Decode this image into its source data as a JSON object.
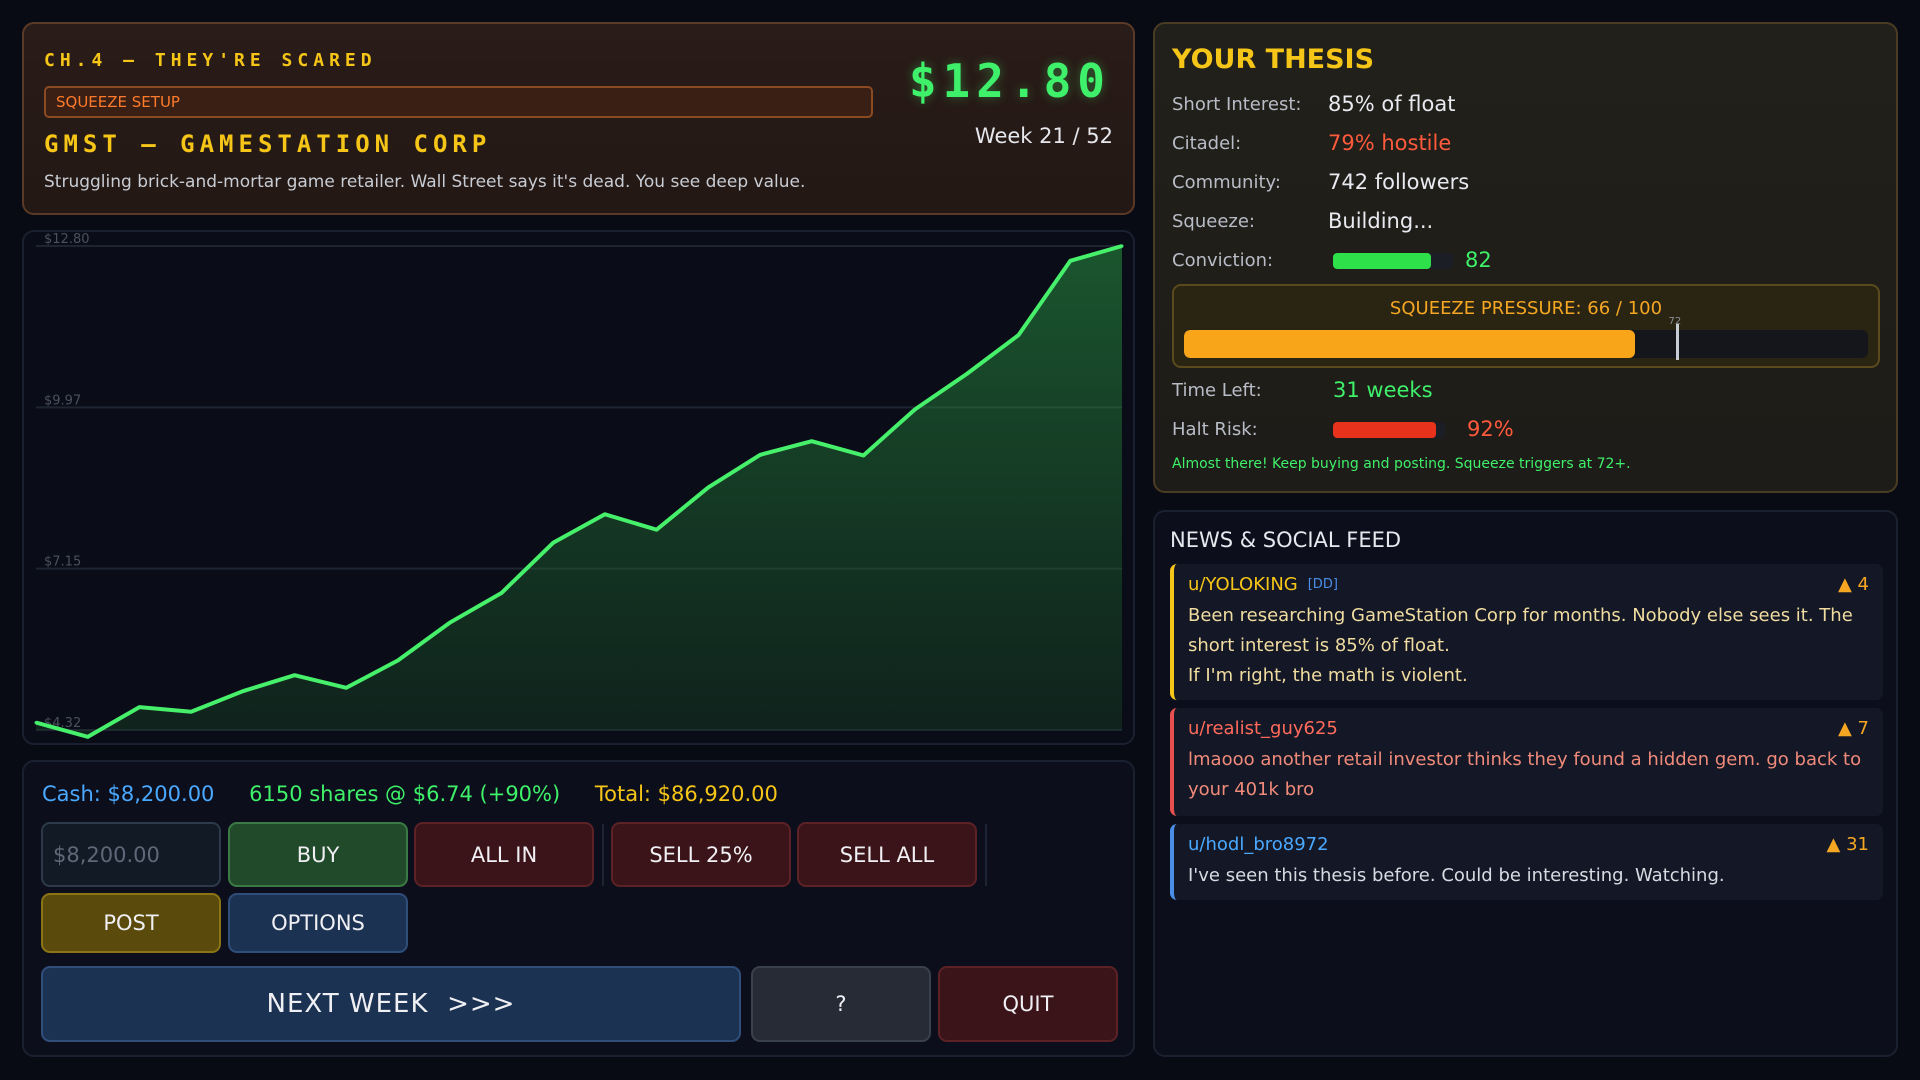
{
  "header": {
    "chapter": "CH.4 — THEY'RE SCARED",
    "tag": "SQUEEZE SETUP",
    "ticker": "GMST — GAMESTATION CORP",
    "description": "Struggling brick-and-mortar game retailer. Wall Street says it's dead. You see deep value.",
    "price": "$12.80",
    "week": "Week 21 / 52"
  },
  "chart_data": {
    "type": "area",
    "title": "",
    "xlabel": "",
    "ylabel": "",
    "ytick_labels": [
      "$12.80",
      "$9.97",
      "$7.15",
      "$4.32"
    ],
    "ylim": [
      4.32,
      12.8
    ],
    "grid": true,
    "x": [
      1,
      2,
      3,
      4,
      5,
      6,
      7,
      8,
      9,
      10,
      11,
      12,
      13,
      14,
      15,
      16,
      17,
      18,
      19,
      20,
      21,
      22
    ],
    "values": [
      4.45,
      4.2,
      4.72,
      4.64,
      5.0,
      5.28,
      5.06,
      5.54,
      6.2,
      6.72,
      7.6,
      8.1,
      7.83,
      8.57,
      9.14,
      9.38,
      9.13,
      9.94,
      10.56,
      11.24,
      12.54,
      12.8
    ],
    "color": "#47f06a"
  },
  "trade": {
    "cash": "Cash: $8,200.00",
    "shares": "6150 shares @ $6.74 (+90%)",
    "total": "Total: $86,920.00",
    "amount_placeholder": "$8,200.00",
    "buy": "BUY",
    "all_in": "ALL IN",
    "sell_25": "SELL 25%",
    "sell_all": "SELL ALL",
    "post": "POST",
    "options": "OPTIONS",
    "next_week": "NEXT WEEK  >>>",
    "help": "?",
    "quit": "QUIT"
  },
  "thesis": {
    "title": "YOUR THESIS",
    "short_interest_label": "Short Interest:",
    "short_interest": "85% of float",
    "citadel_label": "Citadel:",
    "citadel": "79% hostile",
    "community_label": "Community:",
    "community": "742 followers",
    "squeeze_label": "Squeeze:",
    "squeeze": "Building...",
    "conviction_label": "Conviction:",
    "conviction": "82",
    "conviction_level": 0.82,
    "pressure_label": "SQUEEZE PRESSURE: 66 / 100",
    "pressure_level": 0.66,
    "pressure_threshold": 0.72,
    "pressure_threshold_label": "72",
    "time_left_label": "Time Left:",
    "time_left": "31 weeks",
    "halt_risk_label": "Halt Risk:",
    "halt_risk": "92%",
    "halt_risk_level": 0.92,
    "hint": "Almost there! Keep buying and posting. Squeeze triggers at 72+."
  },
  "feed": {
    "title": "NEWS & SOCIAL FEED",
    "posts": [
      {
        "user": "u/YOLOKING",
        "tag": "[DD]",
        "votes": "▲ 4",
        "lines": [
          "Been researching GameStation Corp for months. Nobody else sees it. The",
          "short interest is 85% of float.",
          "If I'm right, the math is violent."
        ]
      },
      {
        "user": "u/realist_guy625",
        "votes": "▲ 7",
        "lines": [
          "lmaooo another retail investor thinks they found a hidden gem. go back to",
          "your 401k bro"
        ]
      },
      {
        "user": "u/hodl_bro8972",
        "votes": "▲ 31",
        "lines": [
          "I've seen this thesis before. Could be interesting. Watching."
        ]
      }
    ]
  },
  "colors": {
    "accent_gold": "#f5c518",
    "price_green": "#3ff06a",
    "hostile_red": "#ff5a3c",
    "cash_blue": "#4aa8ff"
  }
}
